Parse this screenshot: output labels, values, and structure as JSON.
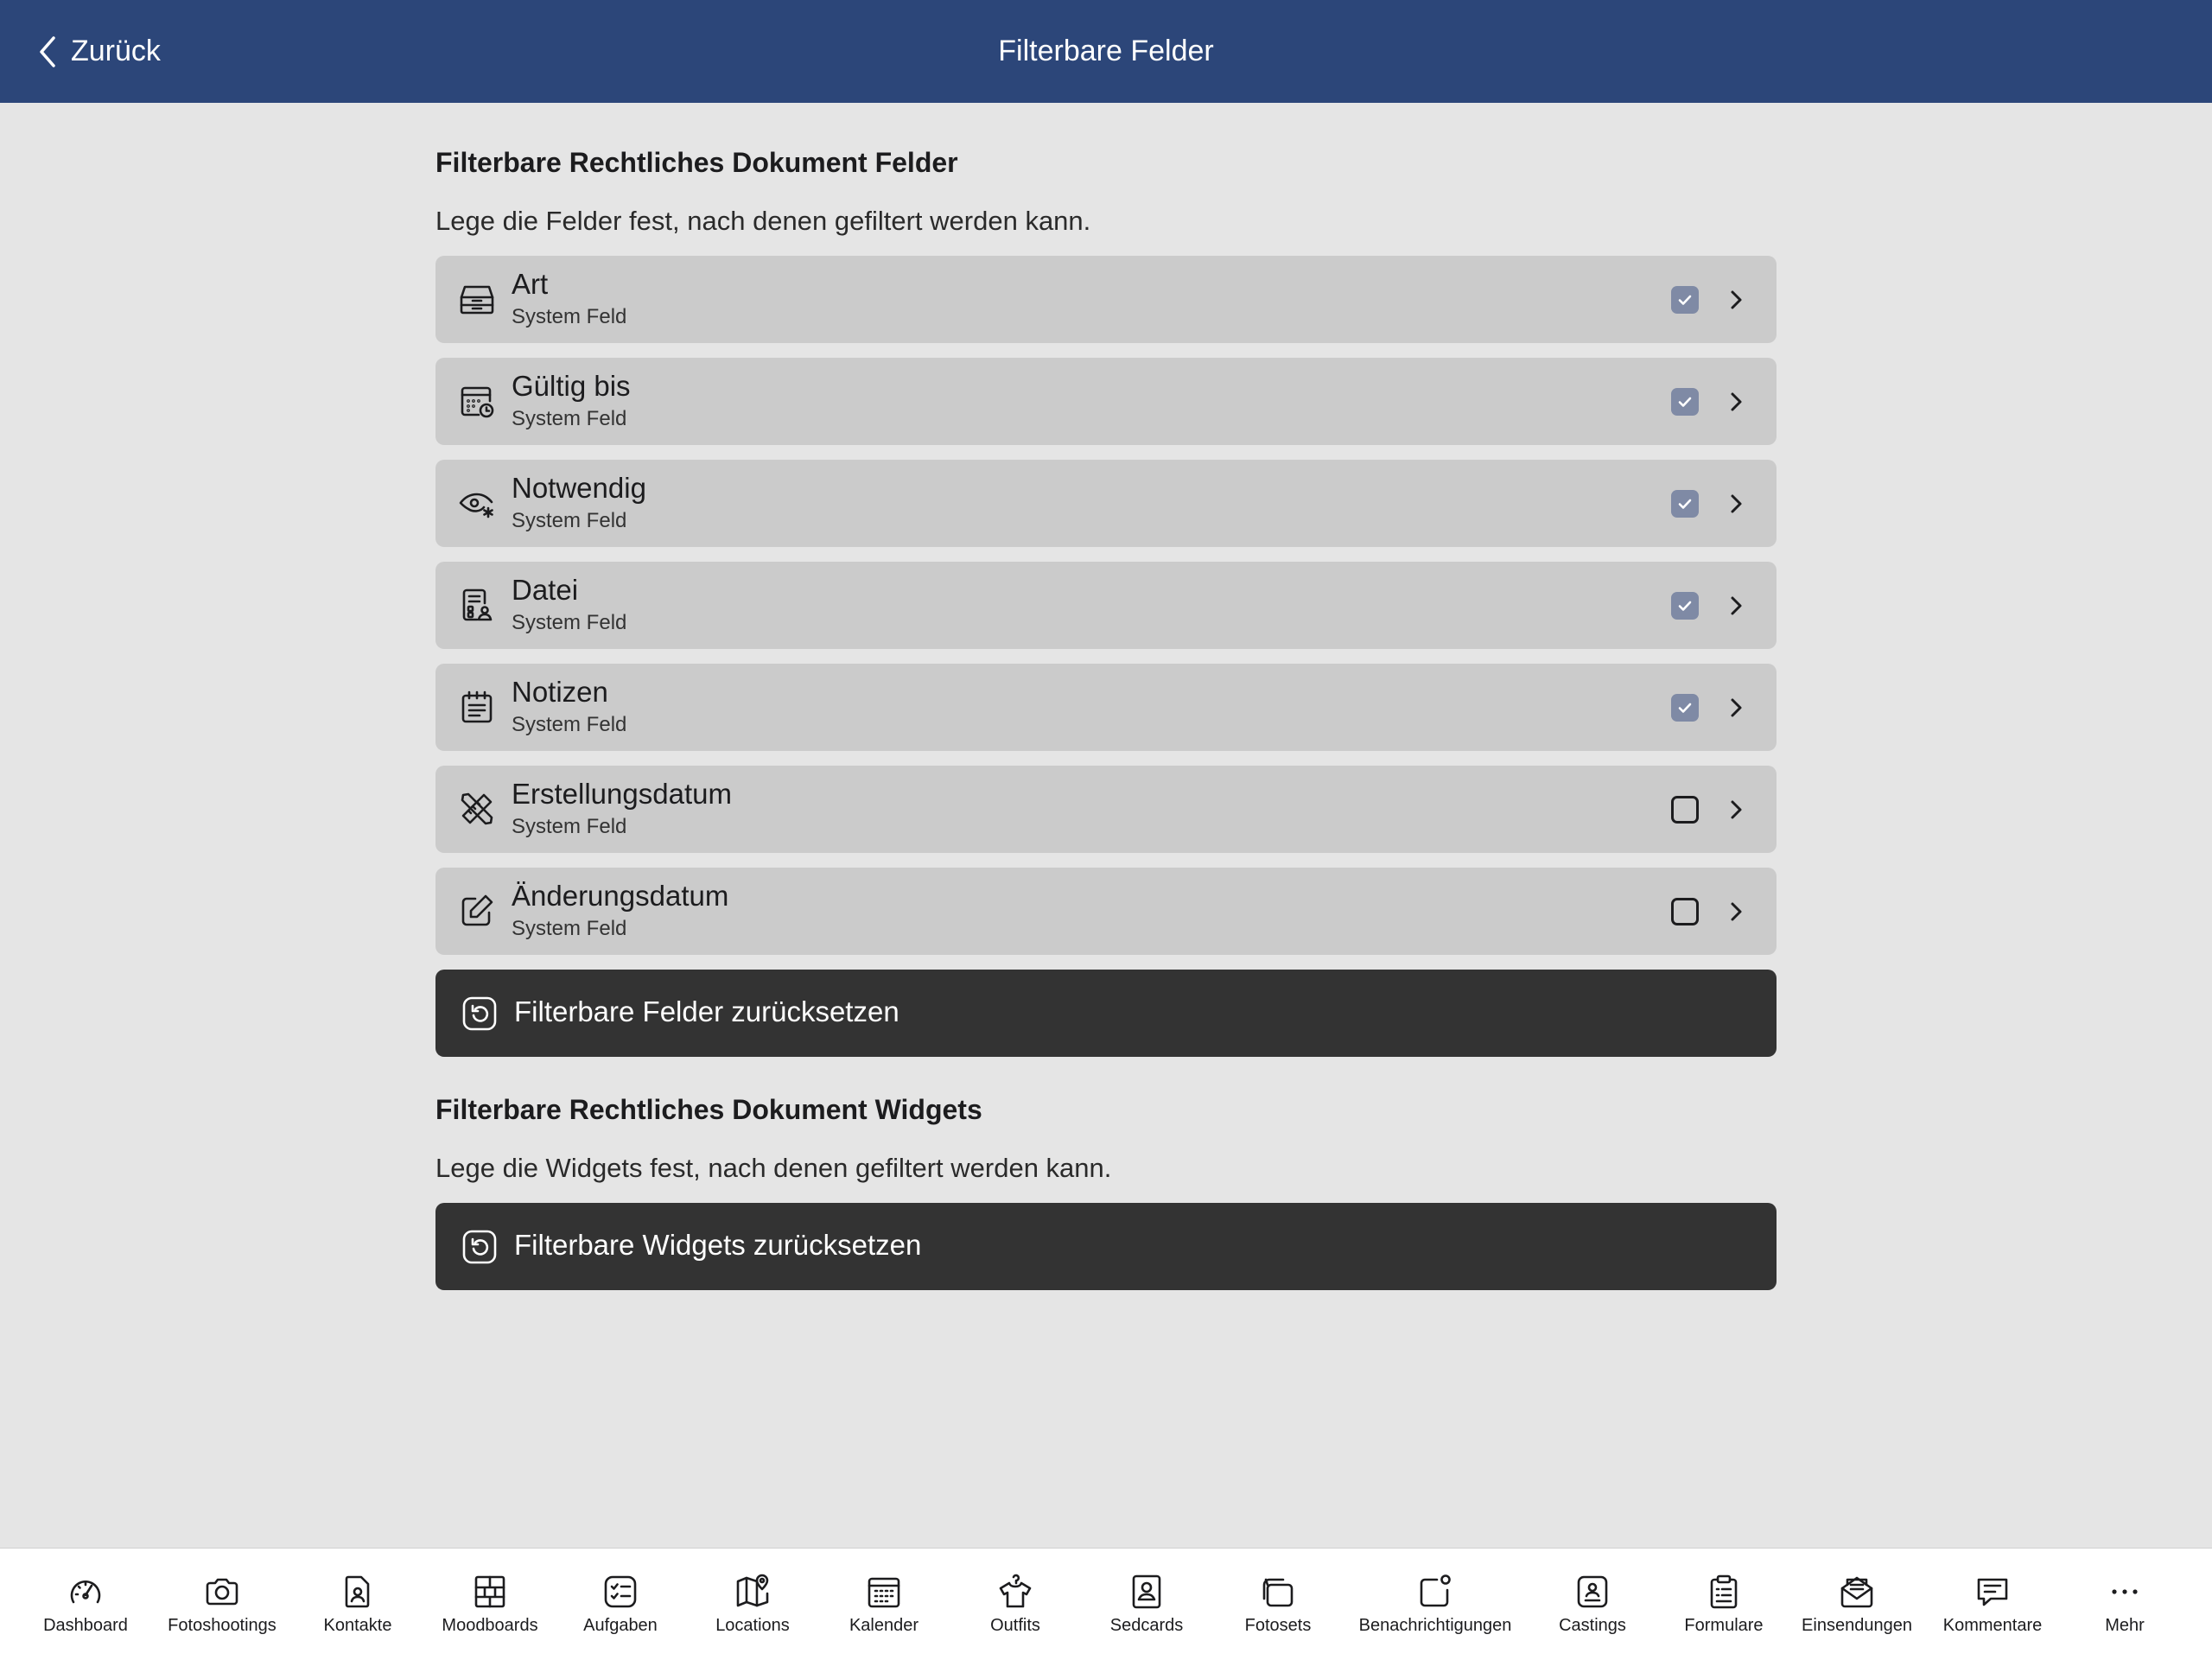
{
  "header": {
    "back_label": "Zurück",
    "title": "Filterbare Felder"
  },
  "fields_section": {
    "title": "Filterbare Rechtliches Dokument Felder",
    "description": "Lege die Felder fest, nach denen gefiltert werden kann.",
    "items": [
      {
        "label": "Art",
        "sub": "System Feld",
        "checked": true,
        "icon": "tray-icon"
      },
      {
        "label": "Gültig bis",
        "sub": "System Feld",
        "checked": true,
        "icon": "calendar-clock-icon"
      },
      {
        "label": "Notwendig",
        "sub": "System Feld",
        "checked": true,
        "icon": "eye-asterisk-icon"
      },
      {
        "label": "Datei",
        "sub": "System Feld",
        "checked": true,
        "icon": "file-person-icon"
      },
      {
        "label": "Notizen",
        "sub": "System Feld",
        "checked": true,
        "icon": "notepad-icon"
      },
      {
        "label": "Erstellungsdatum",
        "sub": "System Feld",
        "checked": false,
        "icon": "pencil-ruler-icon"
      },
      {
        "label": "Änderungsdatum",
        "sub": "System Feld",
        "checked": false,
        "icon": "edit-square-icon"
      }
    ],
    "reset_label": "Filterbare Felder zurücksetzen"
  },
  "widgets_section": {
    "title": "Filterbare Rechtliches Dokument Widgets",
    "description": "Lege die Widgets fest, nach denen gefiltert werden kann.",
    "reset_label": "Filterbare Widgets zurücksetzen"
  },
  "tabbar": {
    "items": [
      {
        "label": "Dashboard",
        "icon": "gauge-icon"
      },
      {
        "label": "Fotoshootings",
        "icon": "camera-icon"
      },
      {
        "label": "Kontakte",
        "icon": "contact-file-icon"
      },
      {
        "label": "Moodboards",
        "icon": "moodboard-icon"
      },
      {
        "label": "Aufgaben",
        "icon": "checklist-icon"
      },
      {
        "label": "Locations",
        "icon": "map-pin-icon"
      },
      {
        "label": "Kalender",
        "icon": "calendar-icon"
      },
      {
        "label": "Outfits",
        "icon": "shirt-hanger-icon"
      },
      {
        "label": "Sedcards",
        "icon": "portrait-card-icon"
      },
      {
        "label": "Fotosets",
        "icon": "photo-stack-icon"
      },
      {
        "label": "Benachrichtigungen",
        "icon": "notification-icon"
      },
      {
        "label": "Castings",
        "icon": "casting-icon"
      },
      {
        "label": "Formulare",
        "icon": "clipboard-icon"
      },
      {
        "label": "Einsendungen",
        "icon": "envelope-icon"
      },
      {
        "label": "Kommentare",
        "icon": "comment-icon"
      },
      {
        "label": "Mehr",
        "icon": "more-dots-icon"
      }
    ]
  },
  "colors": {
    "header_bg": "#2c4679",
    "page_bg": "#e5e5e5",
    "row_bg": "#cbcbcb",
    "button_bg": "#333333",
    "checkbox_checked": "#7f8aa5"
  }
}
